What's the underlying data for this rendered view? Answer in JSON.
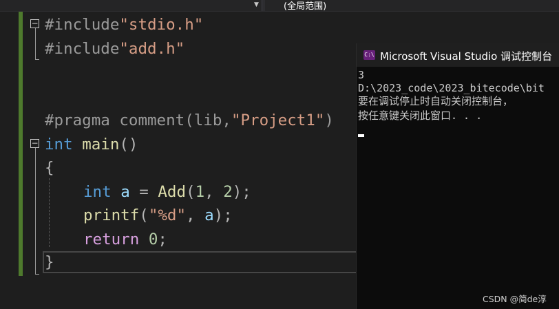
{
  "toolbar": {
    "scope_dropdown_value": "(全局范围)"
  },
  "editor": {
    "lines": {
      "l1": {
        "directive": "#include",
        "path": "\"stdio.h\""
      },
      "l2": {
        "directive": "#include",
        "path": "\"add.h\""
      },
      "l5": {
        "directive": "#pragma comment",
        "open": "(lib,",
        "arg": "\"Project1\"",
        "close": ")"
      },
      "l6": {
        "type": "int",
        "name": "main",
        "parens": "()"
      },
      "l7": {
        "brace": "{"
      },
      "l8": {
        "type": "int",
        "var": "a",
        "eq": " = ",
        "call": "Add",
        "open": "(",
        "n1": "1",
        "comma": ", ",
        "n2": "2",
        "close": ");"
      },
      "l9": {
        "call": "printf",
        "open": "(",
        "fmt": "\"%d\"",
        "comma": ", ",
        "var": "a",
        "close": ");"
      },
      "l10": {
        "kw": "return",
        "num": "0",
        "semi": ";"
      },
      "l11": {
        "brace": "}"
      }
    }
  },
  "console": {
    "title": "Microsoft Visual Studio 调试控制台",
    "icon_text": "C:\\",
    "output": [
      "3",
      "D:\\2023_code\\2023_bitecode\\bit",
      "要在调试停止时自动关闭控制台，",
      "按任意键关闭此窗口. . ."
    ]
  },
  "watermark": "CSDN @简de淳"
}
